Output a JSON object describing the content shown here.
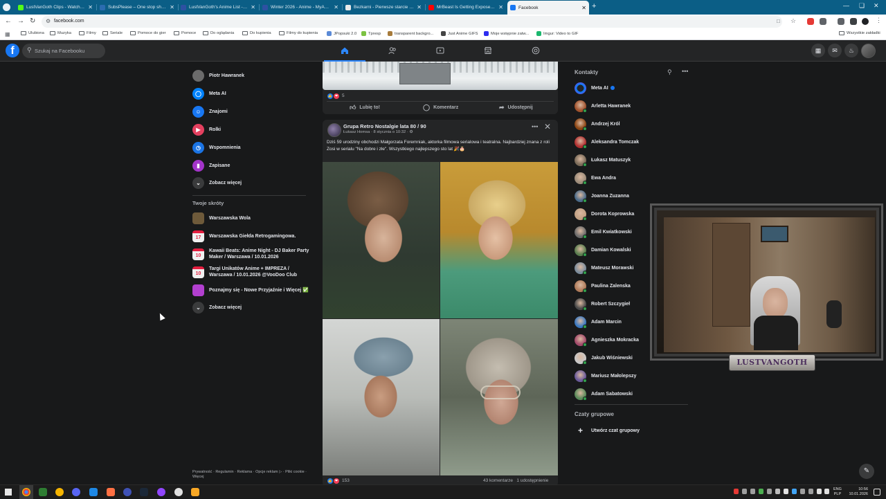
{
  "browser": {
    "tabs": [
      {
        "label": "LustVanGoth Clips - Watch Live",
        "favicon_color": "#53fc18"
      },
      {
        "label": "SubsPlease – One stop shop for",
        "favicon_color": "#2b6cb0"
      },
      {
        "label": "LustVanGoth's Anime List - My",
        "favicon_color": "#2e51a2"
      },
      {
        "label": "Winter 2026 - Anime - MyAnime",
        "favicon_color": "#2e51a2"
      },
      {
        "label": "Bezkarni - Pierwsze starcie / Th",
        "favicon_color": "#e9e9e9"
      },
      {
        "label": "MrBeast Is Getting Exposed... A",
        "favicon_color": "#ff0000"
      },
      {
        "label": "Facebook",
        "favicon_color": "#1877f2",
        "active": true
      }
    ],
    "new_tab_symbol": "+",
    "url": "facebook.com",
    "bookmarks": [
      {
        "label": "Ulubiona",
        "type": "folder"
      },
      {
        "label": "Muzyka",
        "type": "folder"
      },
      {
        "label": "Filmy",
        "type": "folder"
      },
      {
        "label": "Seriale",
        "type": "folder"
      },
      {
        "label": "Pomoce do gier",
        "type": "folder"
      },
      {
        "label": "Pomoce",
        "type": "folder"
      },
      {
        "label": "Do oglądania",
        "type": "folder"
      },
      {
        "label": "Do kupienia",
        "type": "folder"
      },
      {
        "label": "Filmy do kupienia",
        "type": "folder"
      },
      {
        "label": "JPopsuki 2.0",
        "type": "site",
        "color": "#5b8ad6"
      },
      {
        "label": "Tpresp",
        "type": "site",
        "color": "#7cc242"
      },
      {
        "label": "transparent backgro...",
        "type": "site",
        "color": "#a77b3b"
      },
      {
        "label": "Just Anime GIFS",
        "type": "site",
        "color": "#444444"
      },
      {
        "label": "Moje wstępnie zatw...",
        "type": "site",
        "color": "#2d2df0"
      },
      {
        "label": "Imgur: Video to GIF",
        "type": "site",
        "color": "#1bb76e"
      }
    ],
    "bookmarks_all": "Wszystkie zakładki"
  },
  "facebook": {
    "logo": "f",
    "search_placeholder": "Szukaj na Facebooku",
    "left_menu": [
      {
        "label": "Piotr Hawranek",
        "icon": "user-avatar",
        "color": "#6b6b6b"
      },
      {
        "label": "Meta AI",
        "icon": "meta-ai-icon",
        "color": "#0082fb"
      },
      {
        "label": "Znajomi",
        "icon": "friends-icon",
        "color": "#1877f2"
      },
      {
        "label": "Rolki",
        "icon": "reels-icon",
        "color": "#e4405f"
      },
      {
        "label": "Wspomnienia",
        "icon": "memories-icon",
        "color": "#1b74e4"
      },
      {
        "label": "Zapisane",
        "icon": "saved-icon",
        "color": "#a334c9"
      },
      {
        "label": "Zobacz więcej",
        "icon": "chevron-down-icon",
        "color": "#3a3b3c"
      }
    ],
    "shortcuts_title": "Twoje skróty",
    "shortcuts": [
      {
        "label": "Warszawska Wola",
        "kind": "image",
        "color": "#6e5a3a"
      },
      {
        "label": "Warszawska Giełda Retrogamingowa.",
        "kind": "event",
        "day": "17"
      },
      {
        "label": "Kawaii Beats: Anime Night - DJ Baker Party Maker / Warszawa / 10.01.2026",
        "kind": "event",
        "day": "10"
      },
      {
        "label": "Targi Unikatów Anime + IMPREZA / Warszawa / 10.01.2026 @VooDoo Club",
        "kind": "event",
        "day": "10"
      },
      {
        "label": "Poznajmy się - Nowe Przyjaźnie i Więcej ✅",
        "kind": "image",
        "color": "#b23fcf"
      },
      {
        "label": "Zobacz więcej",
        "kind": "more"
      }
    ],
    "footer": "Prywatność · Regulamin · Reklama · Opcje reklam ▷ · Pliki cookie · Więcej",
    "post1": {
      "reaction_count": "5",
      "actions": {
        "like": "Lubię to!",
        "comment": "Komentarz",
        "share": "Udostępnij"
      }
    },
    "post2": {
      "group_name": "Grupa Retro Nostalgie lata 80 / 90",
      "meta": "Łukasz Homsa · 8 stycznia o 10:32 · ⚙",
      "text": "Dziś 59 urodziny obchodzi Małgorzata Foremniak, aktorka filmowa serialowa i teatralna. Najbardziej znana z roli Zosi w serialu \"Na dobre i złe\". Wszystkiego najlepszego sto lat 🎉🎂",
      "reaction_count": "153",
      "comments": "43 komentarze",
      "shares": "1 udostępnienie"
    },
    "contacts_title": "Kontakty",
    "contacts": [
      {
        "name": "Meta AI",
        "color": "#0082fb",
        "online": false,
        "verified": true
      },
      {
        "name": "Arletta Hawranek",
        "color": "#a0522d",
        "online": true
      },
      {
        "name": "Andrzej Król",
        "color": "#8b4513",
        "online": true
      },
      {
        "name": "Aleksandra Tomczak",
        "color": "#b03030",
        "online": true
      },
      {
        "name": "Łukasz Matuszyk",
        "color": "#7a6a58",
        "online": true
      },
      {
        "name": "Ewa Andra",
        "color": "#9c8c7a",
        "online": true
      },
      {
        "name": "Joanna Zuzanna",
        "color": "#4b6b8a",
        "online": true
      },
      {
        "name": "Dorota Koprowska",
        "color": "#c2a184",
        "online": true
      },
      {
        "name": "Emil Kwiatkowski",
        "color": "#6b6b6b",
        "online": true
      },
      {
        "name": "Damian Kowalski",
        "color": "#5a7d4e",
        "online": true
      },
      {
        "name": "Mateusz Morawski",
        "color": "#7b8c9c",
        "online": true
      },
      {
        "name": "Paulina Zalenska",
        "color": "#b07b5a",
        "online": true
      },
      {
        "name": "Robert Szczygieł",
        "color": "#4a4a4a",
        "online": true
      },
      {
        "name": "Adam Marcin",
        "color": "#3a78c0",
        "online": true
      },
      {
        "name": "Agnieszka Mokracka",
        "color": "#a24a6a",
        "online": true
      },
      {
        "name": "Jakub Wiśniewski",
        "color": "#c8c8c8",
        "online": true
      },
      {
        "name": "Mariusz Małolepszy",
        "color": "#6a5a9a",
        "online": true
      },
      {
        "name": "Adam Sabatowski",
        "color": "#5a8a5a",
        "online": true
      }
    ],
    "group_chats_title": "Czaty grupowe",
    "create_group": "Utwórz czat grupowy"
  },
  "webcam": {
    "nameplate": "LUSTVANGOTH"
  },
  "taskbar": {
    "lang": [
      "ENG",
      "PLP"
    ],
    "time": "10:56",
    "date": "10.01.2026"
  }
}
